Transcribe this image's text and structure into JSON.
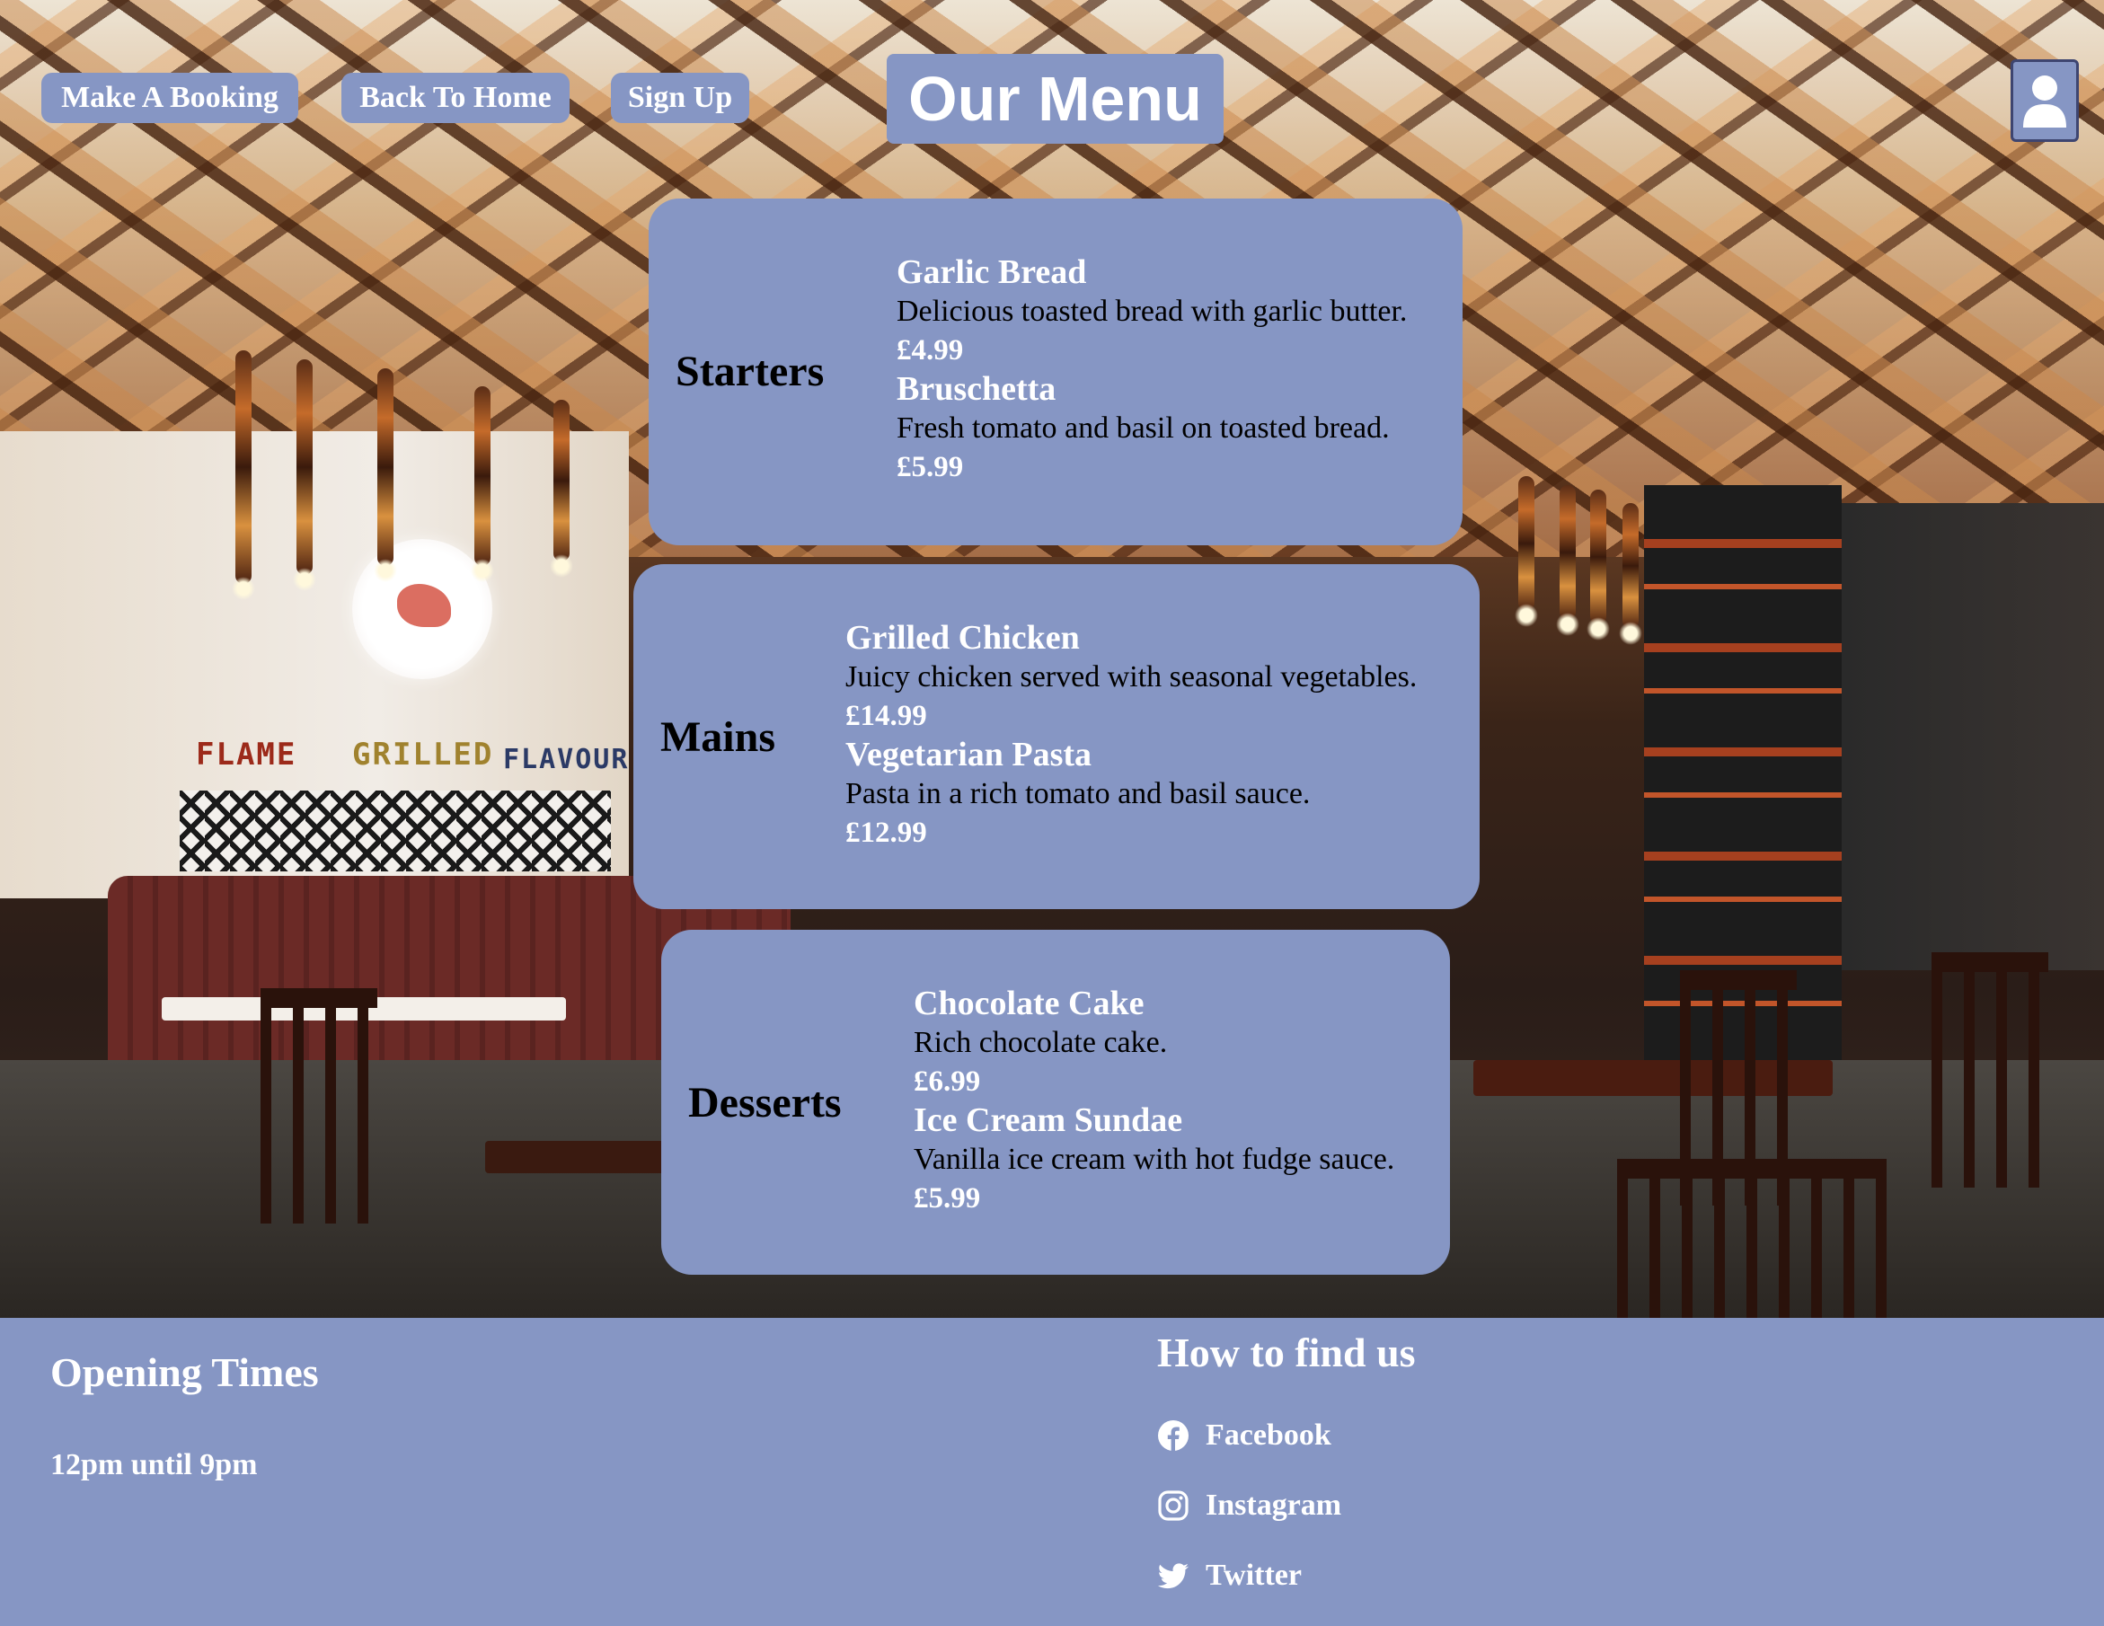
{
  "nav": {
    "booking_label": "Make A Booking",
    "home_label": "Back To Home",
    "signup_label": "Sign Up",
    "profile_icon": "user-icon"
  },
  "page": {
    "title": "Our Menu"
  },
  "menu": {
    "starters": {
      "title": "Starters",
      "items": [
        {
          "name": "Garlic Bread",
          "description": "Delicious toasted bread with garlic butter.",
          "price": "£4.99"
        },
        {
          "name": "Bruschetta",
          "description": "Fresh tomato and basil on toasted bread.",
          "price": "£5.99"
        }
      ]
    },
    "mains": {
      "title": "Mains",
      "items": [
        {
          "name": "Grilled Chicken",
          "description": "Juicy chicken served with seasonal vegetables.",
          "price": "£14.99"
        },
        {
          "name": "Vegetarian Pasta",
          "description": "Pasta in a rich tomato and basil sauce.",
          "price": "£12.99"
        }
      ]
    },
    "desserts": {
      "title": "Desserts",
      "items": [
        {
          "name": "Chocolate Cake",
          "description": "Rich chocolate cake.",
          "price": "£6.99"
        },
        {
          "name": "Ice Cream Sundae",
          "description": "Vanilla ice cream with hot fudge sauce.",
          "price": "£5.99"
        }
      ]
    }
  },
  "footer": {
    "opening_title": "Opening Times",
    "opening_hours": "12pm until 9pm",
    "find_title": "How to find us",
    "social": [
      {
        "label": "Facebook",
        "icon": "facebook-icon"
      },
      {
        "label": "Instagram",
        "icon": "instagram-icon"
      },
      {
        "label": "Twitter",
        "icon": "twitter-icon"
      }
    ]
  },
  "background_sign": {
    "word1": "FLAME",
    "word2": "GRILLED",
    "word3": "FLAVOUR"
  },
  "colors": {
    "accent": "#8696c4",
    "text_dark": "#000000",
    "text_light": "#ffffff"
  }
}
